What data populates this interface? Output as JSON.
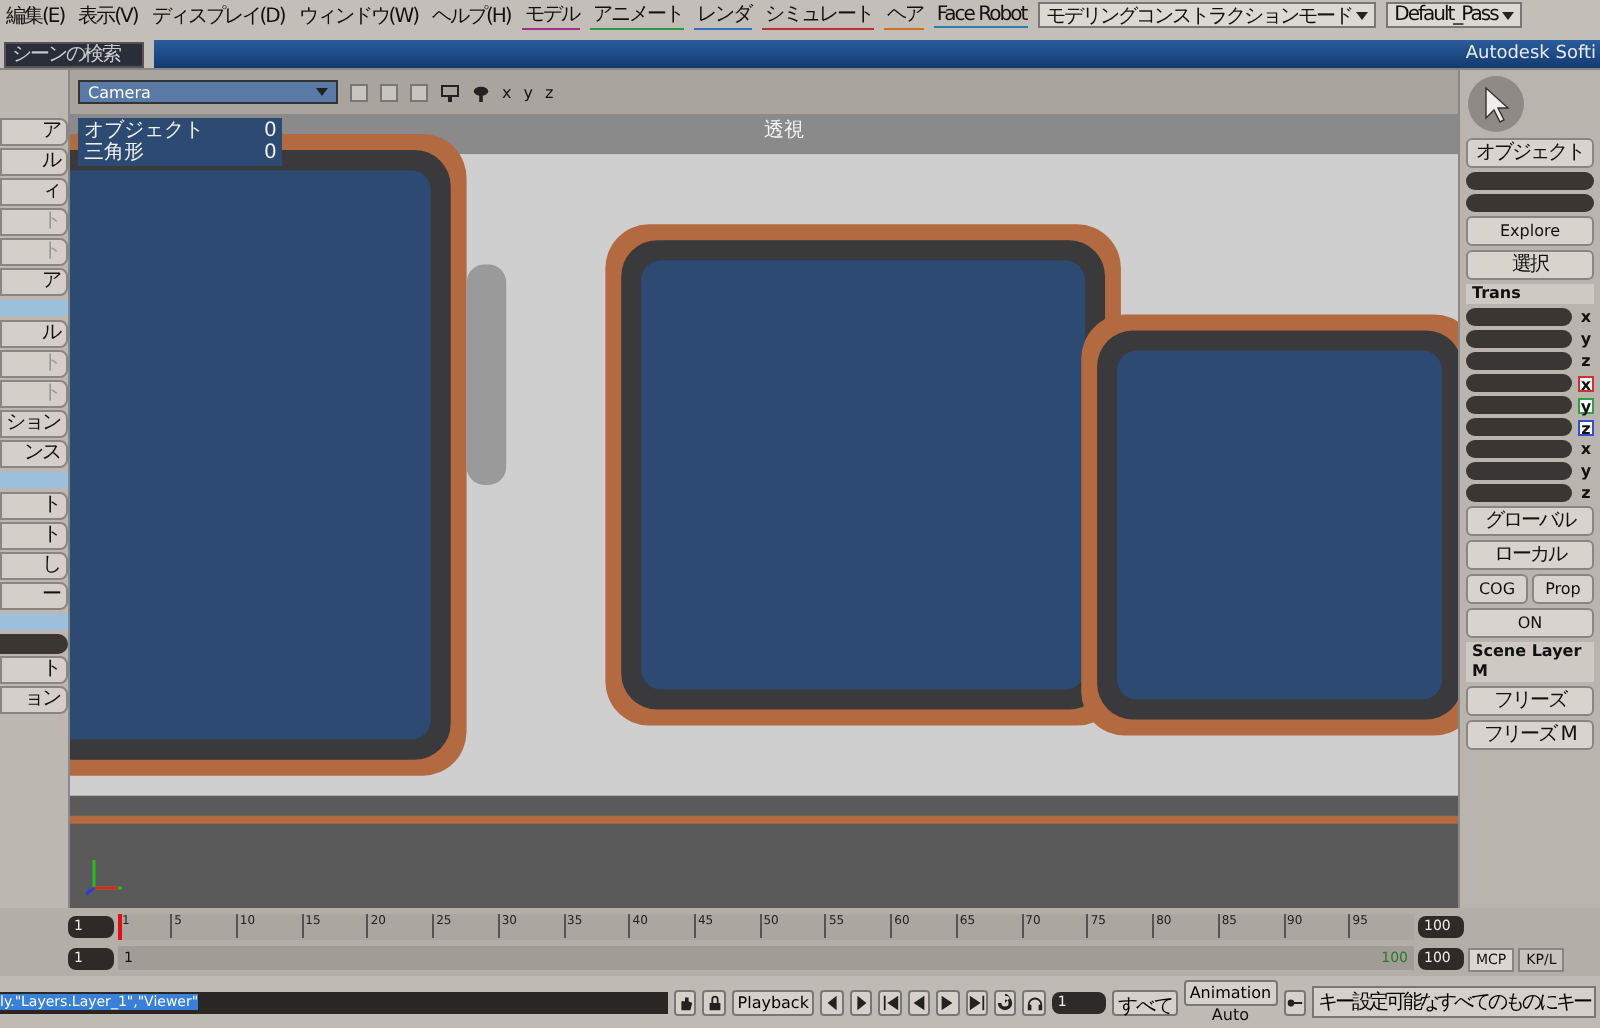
{
  "menu_bar": {
    "menus": [
      {
        "label": "編集(E)"
      },
      {
        "label": "表示(V)"
      },
      {
        "label": "ディスプレイ(D)"
      },
      {
        "label": "ウィンドウ(W)"
      },
      {
        "label": "ヘルプ(H)"
      },
      {
        "label": "モデル",
        "color": "#a0308a"
      },
      {
        "label": "アニメート",
        "color": "#2a9a40"
      },
      {
        "label": "レンダ",
        "color": "#3070c0"
      },
      {
        "label": "シミュレート",
        "color": "#c03030"
      },
      {
        "label": "ヘア",
        "color": "#d07020"
      },
      {
        "label": "Face Robot",
        "color": "#2a80b0"
      }
    ],
    "mode_dropdown": "モデリングコンストラクションモード",
    "pass_dropdown": "Default_Pass",
    "search": {
      "placeholder": "シーンの検索"
    },
    "app_title": "Autodesk Softi"
  },
  "viewport": {
    "camera_dropdown": "Camera",
    "axis_labels": [
      "x",
      "y",
      "z"
    ],
    "view_name": "透視",
    "stats": [
      {
        "label": "オブジェクト",
        "value": "0"
      },
      {
        "label": "三角形",
        "value": "0"
      }
    ]
  },
  "left_toolbar": {
    "items": [
      {
        "kind": "button",
        "label": "ア",
        "disabled": false
      },
      {
        "kind": "button",
        "label": "ル",
        "disabled": false
      },
      {
        "kind": "button",
        "label": "ィ",
        "disabled": false
      },
      {
        "kind": "button",
        "label": "ト",
        "disabled": true
      },
      {
        "kind": "button",
        "label": "ト",
        "disabled": true
      },
      {
        "kind": "button",
        "label": "ア",
        "disabled": false
      },
      {
        "kind": "header"
      },
      {
        "kind": "button",
        "label": "ル",
        "disabled": false
      },
      {
        "kind": "button",
        "label": "ト",
        "disabled": true
      },
      {
        "kind": "button",
        "label": "ト",
        "disabled": true
      },
      {
        "kind": "button",
        "label": "ション",
        "disabled": false
      },
      {
        "kind": "button",
        "label": "ンス",
        "disabled": false
      },
      {
        "kind": "header"
      },
      {
        "kind": "button",
        "label": "ト",
        "disabled": false
      },
      {
        "kind": "button",
        "label": "ト",
        "disabled": false
      },
      {
        "kind": "button",
        "label": "し",
        "disabled": false
      },
      {
        "kind": "button",
        "label": "ー",
        "disabled": false
      },
      {
        "kind": "header"
      },
      {
        "kind": "field"
      },
      {
        "kind": "button",
        "label": "ト",
        "disabled": false
      },
      {
        "kind": "button",
        "label": "ョン",
        "disabled": false
      }
    ]
  },
  "right_panel": {
    "object_button": "オブジェクト",
    "explore_button": "Explore",
    "select_button": "選択",
    "transform_header": "Trans",
    "transform_rows": [
      {
        "axis": "x"
      },
      {
        "axis": "y"
      },
      {
        "axis": "z"
      },
      {
        "axis": "x",
        "color": "#d03030"
      },
      {
        "axis": "y",
        "color": "#30a040"
      },
      {
        "axis": "z",
        "color": "#3050d0"
      },
      {
        "axis": "x"
      },
      {
        "axis": "y"
      },
      {
        "axis": "z"
      }
    ],
    "global_button": "グローバル",
    "local_button": "ローカル",
    "cog_button": "COG",
    "prop_button": "Prop",
    "on_button": "ON",
    "scene_layer_header": "Scene Layer M",
    "freeze_buttons": [
      "フリーズ",
      "フリーズ M"
    ]
  },
  "timeline": {
    "start_field": "1",
    "range_start_field": "1",
    "ticks": [
      "1",
      "5",
      "10",
      "15",
      "20",
      "25",
      "30",
      "35",
      "40",
      "45",
      "50",
      "55",
      "60",
      "65",
      "70",
      "75",
      "80",
      "85",
      "90",
      "95"
    ],
    "range_label": "1",
    "range_end_label": "100",
    "end_field": "100",
    "range_end_field": "100",
    "tabs": [
      {
        "label": "MCP",
        "selected": true
      },
      {
        "label": "KP/L",
        "selected": false
      }
    ]
  },
  "status_bar": {
    "command_line": "ly.\"Layers.Layer_1\",\"Viewer\"",
    "playback_button": "Playback",
    "frame_field": "1",
    "all_button": "すべて",
    "animation_button": "Animation",
    "auto_label": "Auto",
    "key_button": "キー設定可能なすべてのものにキー"
  }
}
